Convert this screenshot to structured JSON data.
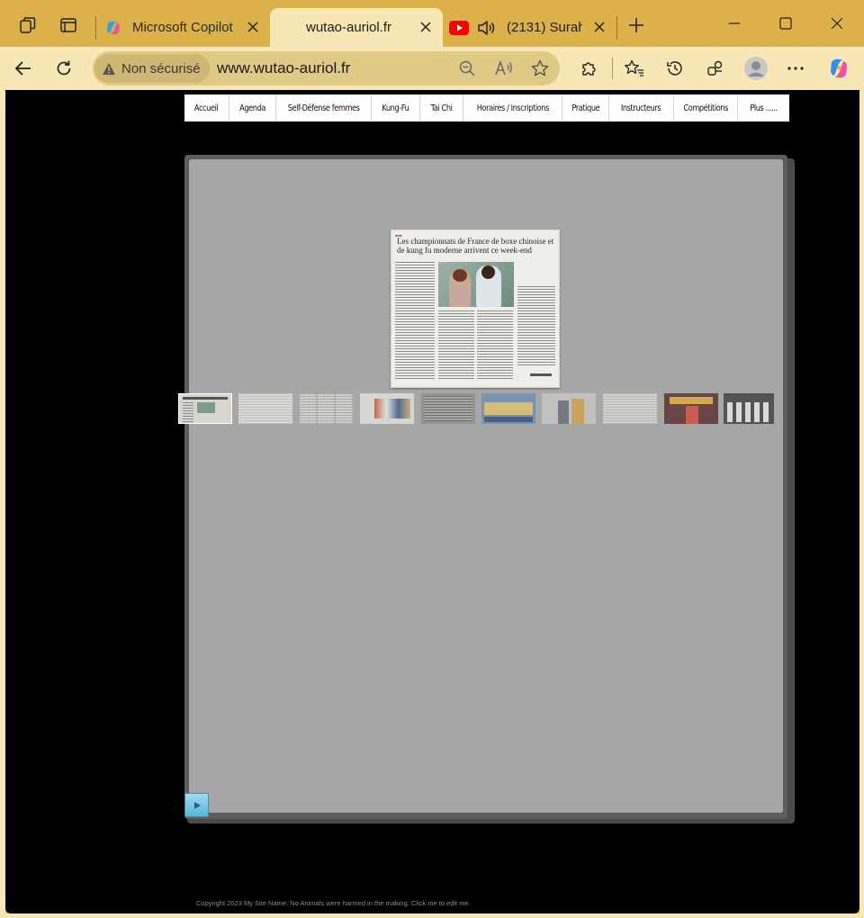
{
  "browser": {
    "tabs": [
      {
        "title": "Microsoft Copilot",
        "icon": "copilot-icon",
        "active": false
      },
      {
        "title": "wutao-auriol.fr",
        "icon": null,
        "active": true
      },
      {
        "title": "(2131) Surah",
        "icon": "youtube-icon",
        "audio": true,
        "active": false
      }
    ],
    "security_label": "Non sécurisé",
    "url": "www.wutao-auriol.fr",
    "colors": {
      "frame": "#dcb14a",
      "toolbar": "#f6e7b4",
      "address_bar": "#dfc986"
    }
  },
  "site": {
    "nav": [
      "Accueil",
      "Agenda",
      "Self-Défense femmes",
      "Kung-Fu",
      "Tai Chi",
      "Horaires / Inscriptions",
      "Pratique",
      "Instructeurs",
      "Compétitions",
      "Plus ......"
    ],
    "gallery": {
      "headline": "Les championnats de France de boxe chinoise et de kung fu moderne arrivent ce week-end",
      "thumbnail_count": 10,
      "active_thumbnail": 1
    },
    "footer": "Copyright 2023 My Site Name. No Animals were harmed in the making. Click me to edit me."
  }
}
